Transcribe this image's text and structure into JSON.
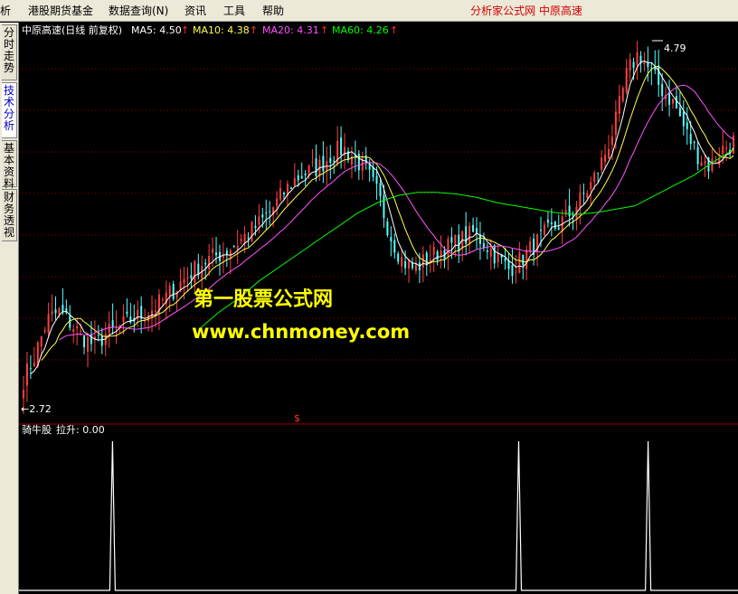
{
  "menu": {
    "items": [
      "分析",
      "港股期货基金",
      "数据查询(N)",
      "资讯",
      "工具",
      "帮助"
    ],
    "right_text": "分析家公式网  中原高速"
  },
  "sidebar": {
    "tabs": [
      "分时走势",
      "技术分析",
      "基本资料",
      "财务透视"
    ],
    "active": 1
  },
  "main_header": {
    "title": "中原高速(日线 前复权)",
    "ma5": "MA5: 4.50",
    "ma10": "MA10: 4.38",
    "ma20": "MA20: 4.31",
    "ma60": "MA60: 4.26",
    "arrow": "↑"
  },
  "annotations": {
    "high": "4.79",
    "low": "←2.72",
    "marker": "$"
  },
  "watermark": {
    "line1": "第一股票公式网",
    "line2": "www.chnmoney.com"
  },
  "sub_header": {
    "name": "骑牛股",
    "value": "拉升: 0.00"
  },
  "colors": {
    "up": "#ff4040",
    "down": "#54ffff",
    "ma5": "#ffffff",
    "ma10": "#ffff54",
    "ma20": "#ff54ff",
    "ma60": "#00ff00",
    "grid": "#8b0000",
    "signal": "#ffffff"
  },
  "chart_data": {
    "type": "line",
    "price_range": [
      2.72,
      4.79
    ],
    "ma_closes": [
      2.8,
      2.95,
      3.15,
      3.2,
      3.13,
      3.05,
      3.0,
      3.07,
      3.1,
      3.15,
      3.18,
      3.22,
      3.28,
      3.35,
      3.42,
      3.48,
      3.52,
      3.55,
      3.6,
      3.66,
      3.72,
      3.8,
      3.9,
      3.98,
      4.02,
      4.05,
      4.12,
      4.16,
      4.1,
      4.02,
      3.88,
      3.65,
      3.5,
      3.45,
      3.5,
      3.55,
      3.58,
      3.62,
      3.66,
      3.6,
      3.52,
      3.45,
      3.5,
      3.58,
      3.65,
      3.7,
      3.76,
      3.85,
      3.95,
      4.1,
      4.3,
      4.6,
      4.72,
      4.6,
      4.5,
      4.42,
      4.25,
      4.12,
      4.05,
      4.15,
      4.2
    ],
    "ma60": [
      3.1,
      3.2,
      3.28,
      3.38,
      3.46,
      3.54,
      3.62,
      3.7,
      3.78,
      3.84,
      3.88,
      3.9,
      3.9,
      3.89,
      3.87,
      3.84,
      3.82,
      3.8,
      3.78,
      3.77,
      3.78,
      3.8,
      3.82,
      3.88,
      3.94,
      4.0,
      4.08,
      4.15
    ],
    "signal_positions": [
      0.13,
      0.695,
      0.875
    ],
    "signal_value": 0.0
  }
}
